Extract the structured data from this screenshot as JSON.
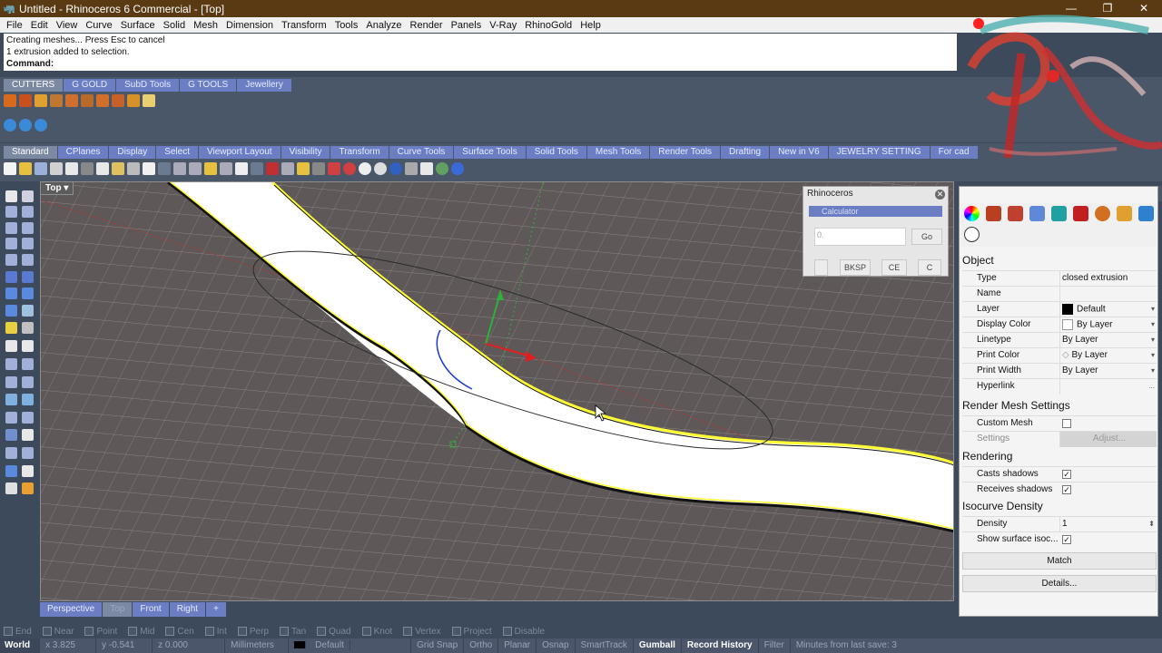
{
  "window": {
    "title": "Untitled - Rhinoceros 6 Commercial - [Top]",
    "controls": [
      "—",
      "❐",
      "✕"
    ]
  },
  "menubar": [
    "File",
    "Edit",
    "View",
    "Curve",
    "Surface",
    "Solid",
    "Mesh",
    "Dimension",
    "Transform",
    "Tools",
    "Analyze",
    "Render",
    "Panels",
    "V-Ray",
    "RhinoGold",
    "Help"
  ],
  "command_history": {
    "line1": "Creating meshes... Press Esc to cancel",
    "line2": "1 extrusion added to selection.",
    "prompt": "Command:"
  },
  "toolbar_tabs_top": [
    "CUTTERS",
    "G GOLD",
    "SubD Tools",
    "G TOOLS",
    "Jewellery"
  ],
  "toolbar_tabs_main": [
    "Standard",
    "CPlanes",
    "Display",
    "Select",
    "Viewport Layout",
    "Visibility",
    "Transform",
    "Curve Tools",
    "Surface Tools",
    "Solid Tools",
    "Mesh Tools",
    "Render Tools",
    "Drafting",
    "New in V6",
    "JEWELRY SETTING",
    "For cad"
  ],
  "viewport": {
    "name": "Top",
    "tabs": [
      "Perspective",
      "Top",
      "Front",
      "Right",
      "+"
    ],
    "active_tab": "Top"
  },
  "calculator": {
    "window_title": "Rhinoceros",
    "panel_title": "Calculator",
    "input_value": "0.",
    "go": "Go",
    "bksp": "BKSP",
    "ce": "CE",
    "c": "C"
  },
  "properties": {
    "section_object": "Object",
    "type_label": "Type",
    "type_value": "closed extrusion",
    "name_label": "Name",
    "name_value": "",
    "layer_label": "Layer",
    "layer_value": "Default",
    "display_color_label": "Display Color",
    "display_color_value": "By Layer",
    "linetype_label": "Linetype",
    "linetype_value": "By Layer",
    "print_color_label": "Print Color",
    "print_color_value": "By Layer",
    "print_width_label": "Print Width",
    "print_width_value": "By Layer",
    "hyperlink_label": "Hyperlink",
    "hyperlink_btn": "...",
    "section_render_mesh": "Render Mesh Settings",
    "custom_mesh_label": "Custom Mesh",
    "settings_label": "Settings",
    "adjust_btn": "Adjust...",
    "section_rendering": "Rendering",
    "casts_shadows_label": "Casts shadows",
    "receives_shadows_label": "Receives shadows",
    "section_isocurve": "Isocurve Density",
    "density_label": "Density",
    "density_value": "1",
    "show_surface_label": "Show surface isoc...",
    "match_btn": "Match",
    "details_btn": "Details..."
  },
  "osnap": [
    "End",
    "Near",
    "Point",
    "Mid",
    "Cen",
    "Int",
    "Perp",
    "Tan",
    "Quad",
    "Knot",
    "Vertex",
    "Project",
    "Disable"
  ],
  "statusbar": {
    "cplane": "World",
    "x": "x 3.825",
    "y": "y -0.541",
    "z": "z 0.000",
    "units": "Millimeters",
    "layer": "Default",
    "grid_snap": "Grid Snap",
    "ortho": "Ortho",
    "planar": "Planar",
    "osnap": "Osnap",
    "smarttrack": "SmartTrack",
    "gumball": "Gumball",
    "record_history": "Record History",
    "filter": "Filter",
    "minutes": "Minutes from last save: 3"
  },
  "colors": {
    "title_bg": "#5a3a12",
    "tab_bg": "#6b7ec4",
    "viewport_bg": "#5e5858",
    "selection": "#ffff33"
  }
}
